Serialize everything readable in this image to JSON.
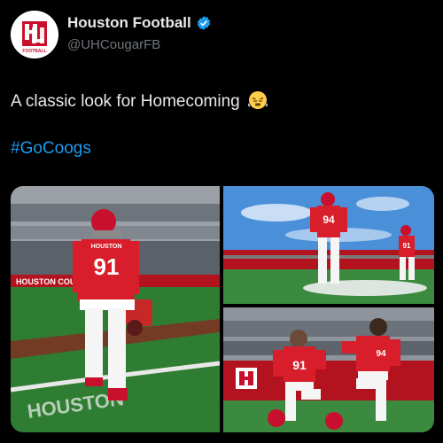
{
  "author": {
    "display_name": "Houston Football",
    "handle": "@UHCougarFB",
    "avatar_icon": "uh-logo-icon",
    "avatar_subtext": "FOOTBALL",
    "verified_icon": "verified-badge-icon",
    "verified_color": "#1d9bf0"
  },
  "tweet": {
    "text": "A classic look for Homecoming",
    "emoji_icon": "huffing-face-emoji-icon",
    "hashtag": "#GoCoogs"
  },
  "media": {
    "photo_1": {
      "wall_text": "HOUSTON COUGARS",
      "jersey_number": "91",
      "chest_text": "HOUSTON",
      "end_zone_text": "HOUSTON"
    },
    "photo_2": {
      "jersey_number_left": "94",
      "jersey_number_right": "91"
    },
    "photo_3": {
      "jersey_number_left": "91",
      "jersey_number_right": "94"
    }
  },
  "colors": {
    "background": "#000000",
    "text": "#e7e9ea",
    "secondary": "#71767b",
    "link": "#1d9bf0",
    "brand_red": "#c8102e"
  }
}
